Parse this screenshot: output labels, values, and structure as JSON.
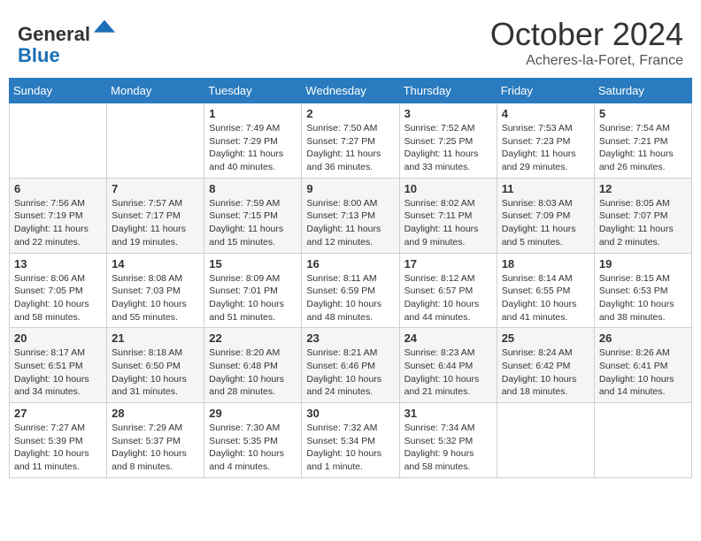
{
  "header": {
    "logo_line1": "General",
    "logo_line2": "Blue",
    "month_title": "October 2024",
    "location": "Acheres-la-Foret, France"
  },
  "days_of_week": [
    "Sunday",
    "Monday",
    "Tuesday",
    "Wednesday",
    "Thursday",
    "Friday",
    "Saturday"
  ],
  "weeks": [
    [
      {
        "day": "",
        "sunrise": "",
        "sunset": "",
        "daylight": ""
      },
      {
        "day": "",
        "sunrise": "",
        "sunset": "",
        "daylight": ""
      },
      {
        "day": "1",
        "sunrise": "Sunrise: 7:49 AM",
        "sunset": "Sunset: 7:29 PM",
        "daylight": "Daylight: 11 hours and 40 minutes."
      },
      {
        "day": "2",
        "sunrise": "Sunrise: 7:50 AM",
        "sunset": "Sunset: 7:27 PM",
        "daylight": "Daylight: 11 hours and 36 minutes."
      },
      {
        "day": "3",
        "sunrise": "Sunrise: 7:52 AM",
        "sunset": "Sunset: 7:25 PM",
        "daylight": "Daylight: 11 hours and 33 minutes."
      },
      {
        "day": "4",
        "sunrise": "Sunrise: 7:53 AM",
        "sunset": "Sunset: 7:23 PM",
        "daylight": "Daylight: 11 hours and 29 minutes."
      },
      {
        "day": "5",
        "sunrise": "Sunrise: 7:54 AM",
        "sunset": "Sunset: 7:21 PM",
        "daylight": "Daylight: 11 hours and 26 minutes."
      }
    ],
    [
      {
        "day": "6",
        "sunrise": "Sunrise: 7:56 AM",
        "sunset": "Sunset: 7:19 PM",
        "daylight": "Daylight: 11 hours and 22 minutes."
      },
      {
        "day": "7",
        "sunrise": "Sunrise: 7:57 AM",
        "sunset": "Sunset: 7:17 PM",
        "daylight": "Daylight: 11 hours and 19 minutes."
      },
      {
        "day": "8",
        "sunrise": "Sunrise: 7:59 AM",
        "sunset": "Sunset: 7:15 PM",
        "daylight": "Daylight: 11 hours and 15 minutes."
      },
      {
        "day": "9",
        "sunrise": "Sunrise: 8:00 AM",
        "sunset": "Sunset: 7:13 PM",
        "daylight": "Daylight: 11 hours and 12 minutes."
      },
      {
        "day": "10",
        "sunrise": "Sunrise: 8:02 AM",
        "sunset": "Sunset: 7:11 PM",
        "daylight": "Daylight: 11 hours and 9 minutes."
      },
      {
        "day": "11",
        "sunrise": "Sunrise: 8:03 AM",
        "sunset": "Sunset: 7:09 PM",
        "daylight": "Daylight: 11 hours and 5 minutes."
      },
      {
        "day": "12",
        "sunrise": "Sunrise: 8:05 AM",
        "sunset": "Sunset: 7:07 PM",
        "daylight": "Daylight: 11 hours and 2 minutes."
      }
    ],
    [
      {
        "day": "13",
        "sunrise": "Sunrise: 8:06 AM",
        "sunset": "Sunset: 7:05 PM",
        "daylight": "Daylight: 10 hours and 58 minutes."
      },
      {
        "day": "14",
        "sunrise": "Sunrise: 8:08 AM",
        "sunset": "Sunset: 7:03 PM",
        "daylight": "Daylight: 10 hours and 55 minutes."
      },
      {
        "day": "15",
        "sunrise": "Sunrise: 8:09 AM",
        "sunset": "Sunset: 7:01 PM",
        "daylight": "Daylight: 10 hours and 51 minutes."
      },
      {
        "day": "16",
        "sunrise": "Sunrise: 8:11 AM",
        "sunset": "Sunset: 6:59 PM",
        "daylight": "Daylight: 10 hours and 48 minutes."
      },
      {
        "day": "17",
        "sunrise": "Sunrise: 8:12 AM",
        "sunset": "Sunset: 6:57 PM",
        "daylight": "Daylight: 10 hours and 44 minutes."
      },
      {
        "day": "18",
        "sunrise": "Sunrise: 8:14 AM",
        "sunset": "Sunset: 6:55 PM",
        "daylight": "Daylight: 10 hours and 41 minutes."
      },
      {
        "day": "19",
        "sunrise": "Sunrise: 8:15 AM",
        "sunset": "Sunset: 6:53 PM",
        "daylight": "Daylight: 10 hours and 38 minutes."
      }
    ],
    [
      {
        "day": "20",
        "sunrise": "Sunrise: 8:17 AM",
        "sunset": "Sunset: 6:51 PM",
        "daylight": "Daylight: 10 hours and 34 minutes."
      },
      {
        "day": "21",
        "sunrise": "Sunrise: 8:18 AM",
        "sunset": "Sunset: 6:50 PM",
        "daylight": "Daylight: 10 hours and 31 minutes."
      },
      {
        "day": "22",
        "sunrise": "Sunrise: 8:20 AM",
        "sunset": "Sunset: 6:48 PM",
        "daylight": "Daylight: 10 hours and 28 minutes."
      },
      {
        "day": "23",
        "sunrise": "Sunrise: 8:21 AM",
        "sunset": "Sunset: 6:46 PM",
        "daylight": "Daylight: 10 hours and 24 minutes."
      },
      {
        "day": "24",
        "sunrise": "Sunrise: 8:23 AM",
        "sunset": "Sunset: 6:44 PM",
        "daylight": "Daylight: 10 hours and 21 minutes."
      },
      {
        "day": "25",
        "sunrise": "Sunrise: 8:24 AM",
        "sunset": "Sunset: 6:42 PM",
        "daylight": "Daylight: 10 hours and 18 minutes."
      },
      {
        "day": "26",
        "sunrise": "Sunrise: 8:26 AM",
        "sunset": "Sunset: 6:41 PM",
        "daylight": "Daylight: 10 hours and 14 minutes."
      }
    ],
    [
      {
        "day": "27",
        "sunrise": "Sunrise: 7:27 AM",
        "sunset": "Sunset: 5:39 PM",
        "daylight": "Daylight: 10 hours and 11 minutes."
      },
      {
        "day": "28",
        "sunrise": "Sunrise: 7:29 AM",
        "sunset": "Sunset: 5:37 PM",
        "daylight": "Daylight: 10 hours and 8 minutes."
      },
      {
        "day": "29",
        "sunrise": "Sunrise: 7:30 AM",
        "sunset": "Sunset: 5:35 PM",
        "daylight": "Daylight: 10 hours and 4 minutes."
      },
      {
        "day": "30",
        "sunrise": "Sunrise: 7:32 AM",
        "sunset": "Sunset: 5:34 PM",
        "daylight": "Daylight: 10 hours and 1 minute."
      },
      {
        "day": "31",
        "sunrise": "Sunrise: 7:34 AM",
        "sunset": "Sunset: 5:32 PM",
        "daylight": "Daylight: 9 hours and 58 minutes."
      },
      {
        "day": "",
        "sunrise": "",
        "sunset": "",
        "daylight": ""
      },
      {
        "day": "",
        "sunrise": "",
        "sunset": "",
        "daylight": ""
      }
    ]
  ]
}
